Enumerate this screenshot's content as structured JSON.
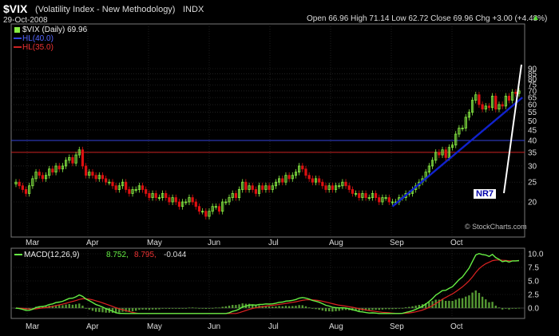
{
  "header": {
    "symbol": "$VIX",
    "name": "(Volatility Index - New Methodology)",
    "exchange": "INDX",
    "date": "29-Oct-2008",
    "ohlc": "Open 66.96  High 71.14  Low 62.72  Close 69.96  Chg +3.00 (+4.48%)",
    "ohlc_arrow": "▲"
  },
  "legend": {
    "price": "$VIX (Daily) 69.96",
    "hl40": "HL(40.0)",
    "hl35": "HL(35.0)",
    "macd_name": "MACD(12,26,9)",
    "macd_v1": "8.752,",
    "macd_v2": "8.795,",
    "macd_v3": "-0.044"
  },
  "annotation": "NR7",
  "watermark": "© StockCharts.com",
  "colors": {
    "up": "#88ee44",
    "down": "#dd1111",
    "hl40": "#3344dd",
    "hl35": "#cc2222",
    "trendline": "#1122cc",
    "macd": "#66ee44",
    "signal": "#dd2222",
    "histogram": "#559933"
  },
  "chart_data": {
    "type": "candlestick",
    "y_ticks": [
      20,
      25,
      30,
      35,
      40,
      45,
      50,
      55,
      60,
      65,
      70,
      75,
      80,
      85,
      90
    ],
    "y_scale": "log",
    "months": [
      "Mar",
      "Apr",
      "May",
      "Jun",
      "Jul",
      "Aug",
      "Sep",
      "Oct"
    ],
    "close": [
      25,
      24,
      23,
      22,
      24,
      26,
      28,
      27,
      26,
      27,
      29,
      28,
      30,
      29,
      30,
      32,
      33,
      31,
      34,
      36,
      30,
      27,
      28,
      27,
      26,
      27,
      26,
      25,
      25,
      24,
      23,
      24,
      25,
      23,
      22,
      23,
      23,
      24,
      23,
      22,
      21,
      22,
      21,
      21,
      22,
      21,
      20,
      21,
      20,
      19,
      20,
      20,
      21,
      20,
      19,
      18,
      18,
      17,
      18,
      19,
      19,
      18,
      20,
      20,
      21,
      22,
      21,
      23,
      25,
      23,
      24,
      23,
      22,
      24,
      23,
      24,
      23,
      24,
      25,
      26,
      25,
      27,
      26,
      27,
      28,
      30,
      29,
      27,
      26,
      25,
      26,
      25,
      24,
      23,
      24,
      23,
      24,
      24,
      25,
      24,
      23,
      22,
      22,
      21,
      22,
      21,
      21,
      22,
      21,
      20,
      21,
      21,
      20,
      20,
      20,
      21,
      21,
      22,
      22,
      23,
      24,
      25,
      26,
      28,
      30,
      32,
      35,
      34,
      36,
      33,
      37,
      38,
      43,
      46,
      46,
      52,
      55,
      63,
      67,
      60,
      57,
      59,
      58,
      66,
      57,
      60,
      59,
      66,
      63,
      69,
      68,
      70
    ],
    "hlines": [
      40,
      35
    ],
    "trendline": {
      "from": [
        113,
        19
      ],
      "to": [
        152,
        65
      ]
    },
    "macd_y_ticks": [
      0.0,
      2.5,
      5.0,
      7.5,
      10.0
    ],
    "macd_value": 8.752,
    "signal_value": 8.795,
    "histogram_value": -0.044
  }
}
